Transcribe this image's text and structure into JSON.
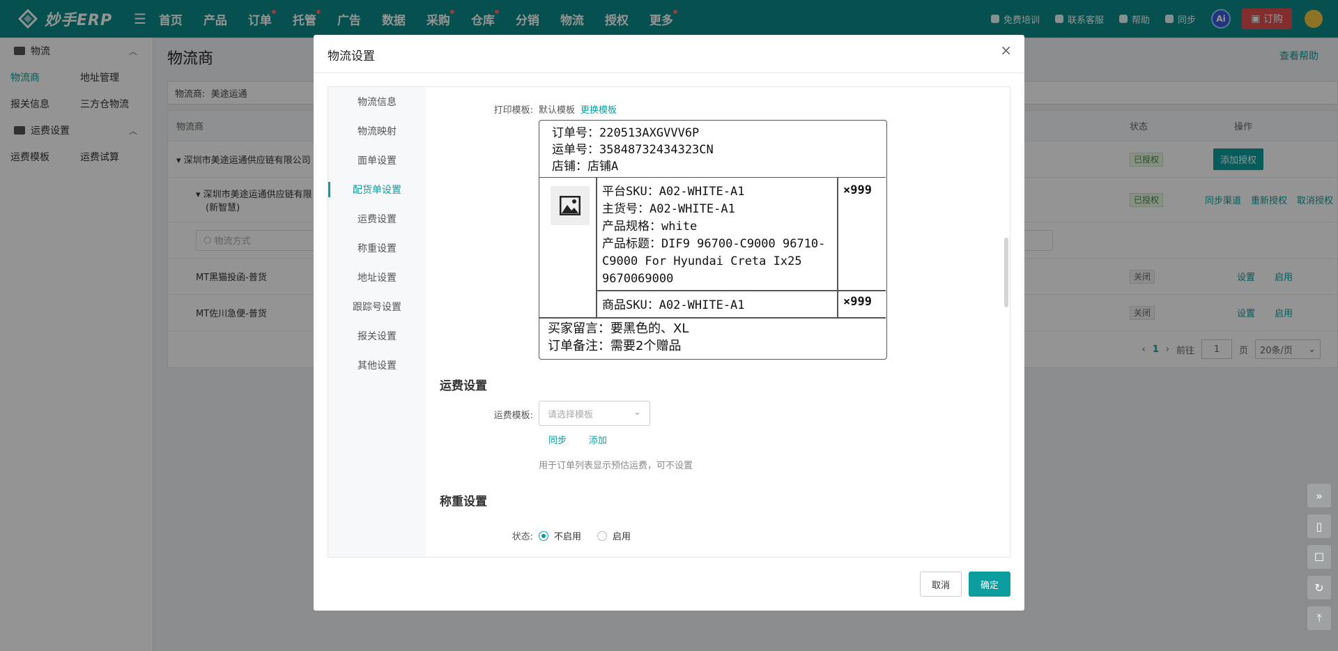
{
  "app": {
    "logo_text": "妙手ERP"
  },
  "topnav": {
    "items": [
      "首页",
      "产品",
      "订单",
      "托管",
      "广告",
      "数据",
      "采购",
      "仓库",
      "分销",
      "物流",
      "授权",
      "更多"
    ],
    "right": {
      "training": "免费培训",
      "contact": "联系客服",
      "help": "帮助",
      "sync": "同步",
      "ai": "Ai",
      "buy": "订购"
    }
  },
  "sidebar": {
    "group1": "物流",
    "row1": [
      "物流商",
      "地址管理"
    ],
    "row2": [
      "报关信息",
      "三方仓物流"
    ],
    "group2": "运费设置",
    "row3": [
      "运费模板",
      "运费试算"
    ]
  },
  "page": {
    "title": "物流商",
    "help": "查看帮助",
    "filter_label": "物流商:",
    "filter_value": "美途运通",
    "table_head": {
      "name": "物流商",
      "status": "状态",
      "ops": "操作"
    },
    "rows": [
      {
        "name": "深圳市美途运通供应链有限公司",
        "status": "已授权",
        "op": "添加授权"
      },
      {
        "name": "深圳市美途运通供应链有限",
        "sub": "(新智慧)",
        "status": "已授权",
        "ops": [
          "同步渠道",
          "重新授权",
          "取消授权"
        ]
      },
      {
        "search_placeholder": "物流方式"
      },
      {
        "name": "MT黑猫投函-普货",
        "status": "关闭",
        "ops": [
          "设置",
          "启用"
        ]
      },
      {
        "name": "MT佐川急便-普货",
        "status": "关闭",
        "ops": [
          "设置",
          "启用"
        ]
      }
    ],
    "pager": {
      "current": "1",
      "goto": "前往",
      "page_input": "1",
      "page_suffix": "页",
      "page_size": "20条/页"
    }
  },
  "modal": {
    "title": "物流设置",
    "tabs": [
      "物流信息",
      "物流映射",
      "面单设置",
      "配货单设置",
      "运费设置",
      "称重设置",
      "地址设置",
      "跟踪号设置",
      "报关设置",
      "其他设置"
    ],
    "active_tab": "配货单设置",
    "print_template": {
      "label": "打印模板:",
      "default": "默认模板",
      "change": "更换模板"
    },
    "preview": {
      "order_no": "订单号：220513AXGVVV6P",
      "waybill": "运单号：35848732434323CN",
      "shop": "店铺：店铺A",
      "platform_sku": "平台SKU：A02-WHITE-A1",
      "main_sku": "主货号：A02-WHITE-A1",
      "spec": "产品规格：white",
      "title": "产品标题：DIF9 96700-C9000 96710-C9000 For Hyundai Creta Ix25 9670069000",
      "qty1": "×999",
      "product_sku": "商品SKU：A02-WHITE-A1",
      "qty2": "×999",
      "buyer_note": "买家留言：要黑色的、XL",
      "order_note": "订单备注：需要2个赠品"
    },
    "freight": {
      "section": "运费设置",
      "label": "运费模板:",
      "placeholder": "请选择模板",
      "sync": "同步",
      "add": "添加",
      "hint": "用于订单列表显示预估运费，可不设置"
    },
    "weigh": {
      "section": "称重设置",
      "label": "状态:",
      "off": "不启用",
      "on": "启用"
    },
    "cancel": "取消",
    "confirm": "确定"
  },
  "colors": {
    "primary": "#0c9e9e",
    "topbar": "#0c8a8a",
    "danger": "#e25050"
  }
}
